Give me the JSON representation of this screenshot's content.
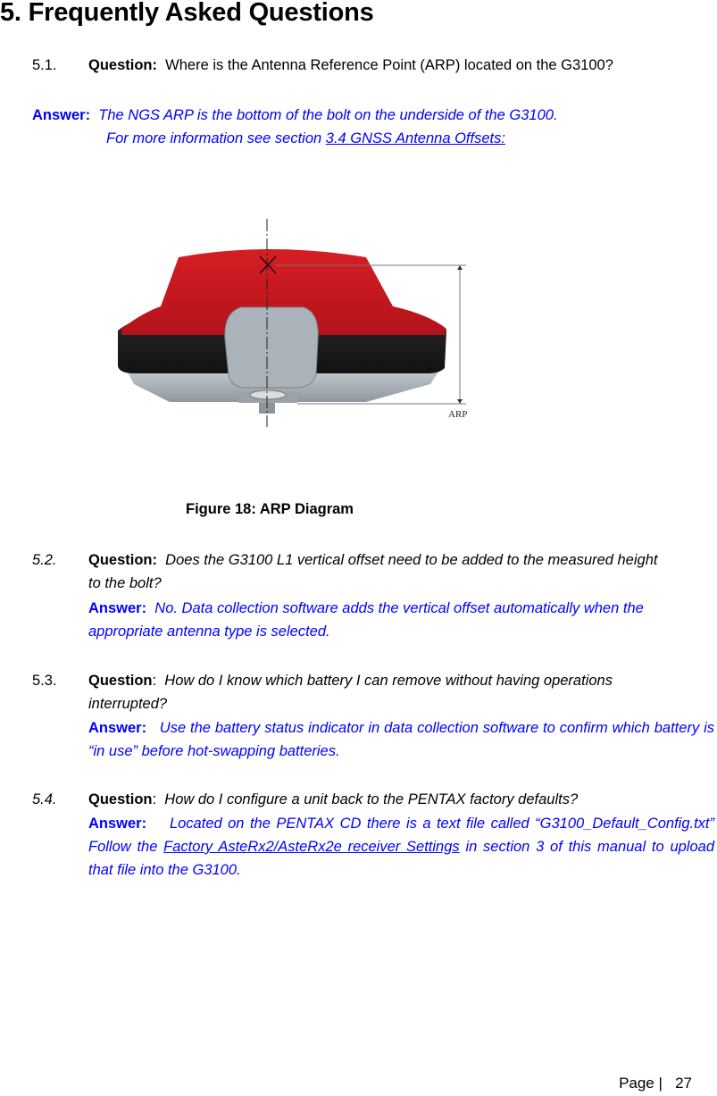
{
  "section_title": "5. Frequently Asked Questions",
  "faq": [
    {
      "number": "5.1.",
      "question_label": "Question:",
      "question_text": "Where is the Antenna Reference Point (ARP) located on the G3100?",
      "answer_label": "Answer:",
      "answer_text": "The NGS ARP is the bottom of the bolt on the underside of the G3100.",
      "answer_text_2": "For more information see section ",
      "answer_link": "3.4 GNSS Antenna Offsets:"
    },
    {
      "number": "5.2.",
      "question_label": "Question:",
      "question_text": "Does the G3100 L1 vertical offset need to be added to the measured height to the bolt?",
      "answer_label": "Answer:",
      "answer_text": "No.  Data collection software adds the vertical offset automatically when the appropriate antenna type is selected."
    },
    {
      "number": "5.3.",
      "question_label": "Question",
      "question_text": "How do I know which battery I can remove without having operations interrupted?",
      "answer_label": "Answer:",
      "answer_text": "Use the battery status indicator in data collection software to confirm which battery is “in use” before hot-swapping batteries."
    },
    {
      "number": "5.4.",
      "question_label": "Question",
      "question_text": "How do I configure a unit back to the PENTAX factory defaults?",
      "answer_label": "Answer:",
      "answer_text": "Located on the PENTAX CD there is a text file called “G3100_Default_Config.txt”  Follow the ",
      "answer_link": "Factory AsteRx2/AsteRx2e receiver Settings",
      "answer_text_2": " in section 3 of this manual to upload that file into the G3100."
    }
  ],
  "figure": {
    "caption": "Figure 18: ARP Diagram",
    "arp_label": "ARP",
    "colors": {
      "dome": "#c8161d",
      "band": "#1e1e1e",
      "base": "#a9b2b8"
    }
  },
  "footer": {
    "page_label": "Page |",
    "page_number": "27"
  },
  "colors": {
    "answer": "#0000ff"
  }
}
